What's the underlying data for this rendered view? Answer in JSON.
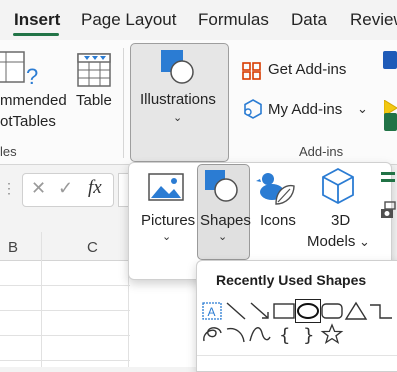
{
  "tabs": [
    {
      "label": "Insert",
      "active": true
    },
    {
      "label": "Page Layout"
    },
    {
      "label": "Formulas"
    },
    {
      "label": "Data"
    },
    {
      "label": "Review"
    }
  ],
  "ribbon": {
    "recommended_pivot_line1": "mmended",
    "recommended_pivot_line2": "otTables",
    "table_label": "Table",
    "tables_group": "les",
    "illustrations_label": "Illustrations",
    "get_addins_label": "Get Add-ins",
    "my_addins_label": "My Add-ins",
    "addins_group": "Add-ins"
  },
  "formula_bar": {
    "cancel_symbol": "✕",
    "enter_symbol": "✓",
    "fx_symbol": "fx"
  },
  "columns": [
    "B",
    "C"
  ],
  "illustrations_menu": {
    "pictures_label": "Pictures",
    "shapes_label": "Shapes",
    "icons_label": "Icons",
    "models_line1": "3D",
    "models_line2": "Models"
  },
  "shapes_gallery": {
    "title": "Recently Used Shapes",
    "row1": [
      "text-box",
      "line",
      "arrow",
      "rectangle",
      "oval",
      "rounded-rectangle",
      "triangle",
      "elbow-connector"
    ],
    "row2": [
      "freeform",
      "arc",
      "curve",
      "left-brace",
      "right-brace",
      "star"
    ]
  },
  "colors": {
    "accent_green": "#217346",
    "icon_blue": "#2b7cd3",
    "addin_red": "#d83b01"
  }
}
